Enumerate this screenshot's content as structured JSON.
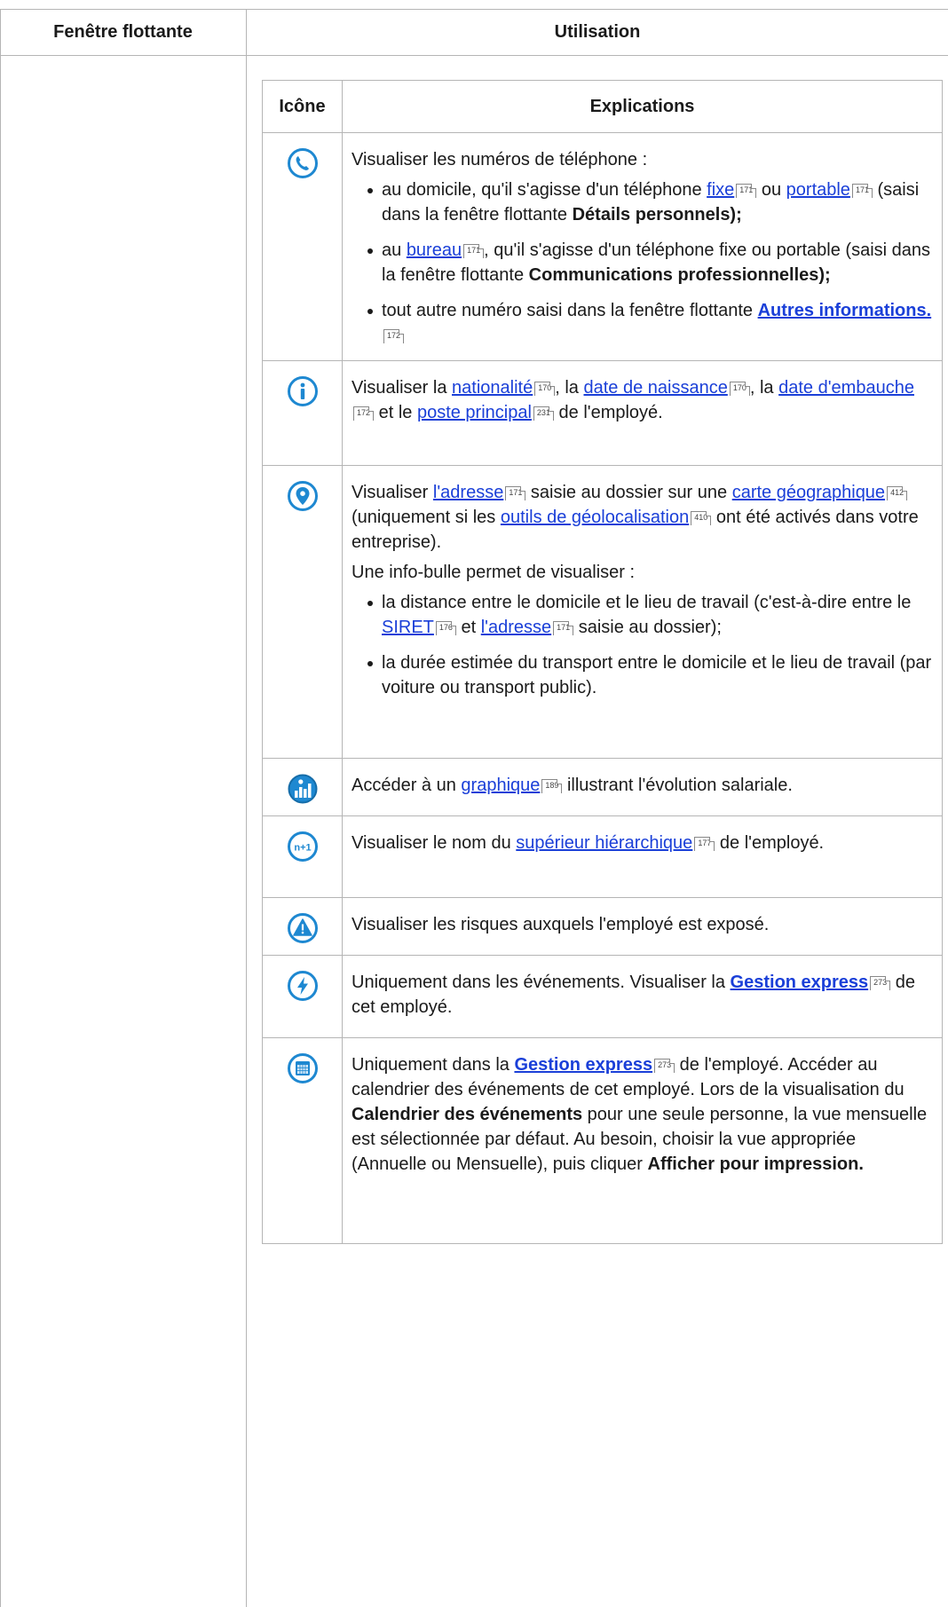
{
  "outer_headers": {
    "left": "Fenêtre flottante",
    "right": "Utilisation"
  },
  "inner_headers": {
    "icon": "Icône",
    "explanations": "Explications"
  },
  "colors": {
    "icon_blue": "#1e88d1",
    "link": "#1a3fd8",
    "border": "#b5b5b5"
  },
  "rows": [
    {
      "icon": "phone-icon",
      "intro": "Visualiser les numéros de téléphone :",
      "items": [
        {
          "t1": "au domicile, qu'il s'agisse d'un téléphone ",
          "l1": "fixe",
          "r1": "171",
          "t2": " ou ",
          "l2": "portable",
          "r2": "171",
          "t3": " (saisi dans la fenêtre flottante ",
          "b1": "Détails personnels);"
        },
        {
          "t1": "au ",
          "l1": "bureau",
          "r1": "171",
          "t2": ", qu'il s'agisse d'un téléphone fixe ou portable (saisi dans la fenêtre flottante ",
          "b1": "Communications professionnelles);"
        },
        {
          "t1": "tout autre numéro saisi dans la fenêtre flottante ",
          "l1": "Autres informations.",
          "r1": "172"
        }
      ]
    },
    {
      "icon": "info-icon",
      "t1": "Visualiser la ",
      "l1": "nationalité",
      "r1": "170",
      "t2": ", la ",
      "l2": "date de naissance",
      "r2": "170",
      "t3": ", la ",
      "l3": "date d'embauche",
      "r3": "172",
      "t4": " et le ",
      "l4": "poste principal",
      "r4": "231",
      "t5": " de l'employé."
    },
    {
      "icon": "location-pin-icon",
      "t1": "Visualiser ",
      "l1": "l'adresse",
      "r1": "171",
      "t2": " saisie au dossier sur une ",
      "l2": "carte géographique",
      "r2": "412",
      "t3": " (uniquement si les ",
      "l3": "outils de géolocalisation",
      "r3": "410",
      "t4": " ont été activés dans votre entreprise).",
      "p2": "Une info-bulle permet de visualiser :",
      "items": [
        {
          "t1": "la distance entre le domicile et le lieu de travail (c'est-à-dire entre le ",
          "l1": "SIRET",
          "r1": "176",
          "t2": " et ",
          "l2": "l'adresse",
          "r2": "171",
          "t3": " saisie au dossier);"
        },
        {
          "t1": "la durée estimée du transport entre le domicile et le lieu de travail (par voiture ou transport public)."
        }
      ]
    },
    {
      "icon": "salary-chart-icon",
      "t1": "Accéder à un ",
      "l1": "graphique",
      "r1": "189",
      "t2": " illustrant l'évolution salariale."
    },
    {
      "icon": "n-plus-1-icon",
      "badge": "n+1",
      "t1": "Visualiser le nom du ",
      "l1": "supérieur hiérarchique",
      "r1": "177",
      "t2": " de l'employé."
    },
    {
      "icon": "warning-icon",
      "t1": "Visualiser les risques auxquels l'employé est exposé."
    },
    {
      "icon": "lightning-icon",
      "t1": "Uniquement dans les événements. Visualiser la ",
      "l1": "Gestion express",
      "r1": "273",
      "t2": " de cet employé."
    },
    {
      "icon": "calendar-icon",
      "t1": "Uniquement dans la ",
      "l1": "Gestion express",
      "r1": "273",
      "t2": " de l'employé. Accéder au calendrier des événements de cet employé. Lors de la visualisation du ",
      "b1": "Calendrier des événements",
      "t3": " pour une seule personne, la vue mensuelle est sélectionnée par défaut. Au besoin, choisir la vue appropriée (Annuelle ou Mensuelle), puis cliquer ",
      "b2": "Afficher pour impression."
    }
  ]
}
